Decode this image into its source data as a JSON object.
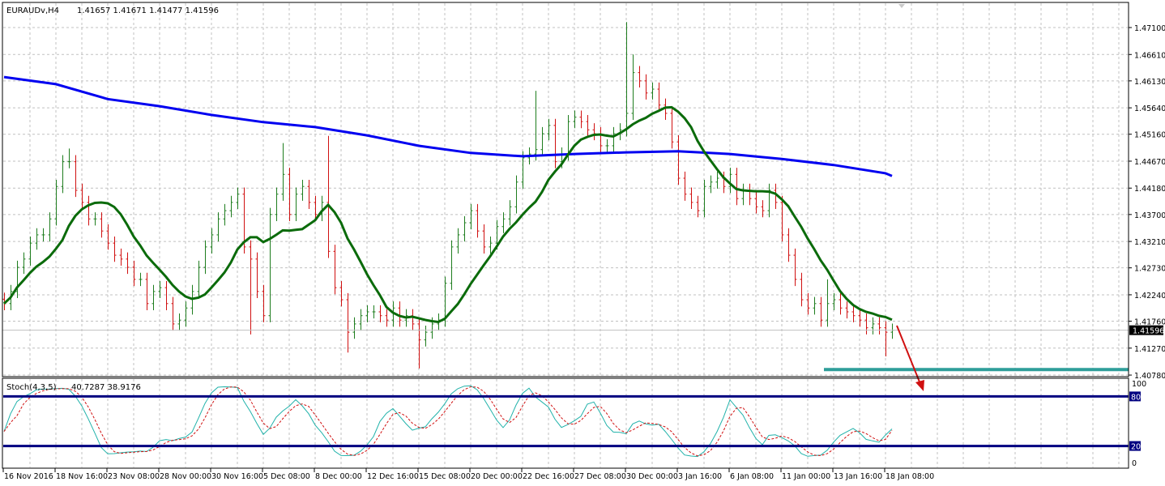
{
  "header": {
    "symbol": "EURAUDv,H4",
    "ohlc": "1.41657 1.41671 1.41477 1.41596"
  },
  "stoch_header": {
    "name": "Stoch(4,3,5)",
    "values": "40.7287 38.9176"
  },
  "colors": {
    "bull_bar": "#1e7d1e",
    "bear_bar": "#d01010",
    "ma_fast": "#0b6b0b",
    "ma_slow": "#0000f0",
    "stoch_main": "#20b2aa",
    "stoch_signal": "#d01010",
    "stoch_levels": "#000080",
    "support_line": "#2e9e9a",
    "arrow": "#d01010",
    "grid": "#c0c0c0"
  },
  "chart_data": [
    {
      "type": "bar",
      "subtype": "ohlc",
      "title": "EURAUDv,H4",
      "price_axis": {
        "ticks": [
          "1.47100",
          "1.46610",
          "1.46130",
          "1.45640",
          "1.45160",
          "1.44670",
          "1.44180",
          "1.43700",
          "1.43210",
          "1.42730",
          "1.42240",
          "1.41760",
          "1.41270",
          "1.40780"
        ],
        "ylim": [
          1.4065,
          1.474
        ],
        "current_price": "1.41596"
      },
      "time_axis": {
        "ticks": [
          "16 Nov 2016",
          "18 Nov 16:00",
          "23 Nov 08:00",
          "28 Nov 00:00",
          "30 Nov 16:00",
          "5 Dec 08:00",
          "8 Dec 00:00",
          "12 Dec 16:00",
          "15 Dec 08:00",
          "20 Dec 00:00",
          "22 Dec 16:00",
          "27 Dec 08:00",
          "30 Dec 00:00",
          "3 Jan 16:00",
          "6 Jan 08:00",
          "11 Jan 00:00",
          "13 Jan 16:00",
          "18 Jan 08:00"
        ]
      },
      "grid": true,
      "closes": [
        1.4208,
        1.423,
        1.4274,
        1.4289,
        1.4318,
        1.4333,
        1.4333,
        1.4362,
        1.4421,
        1.4466,
        1.4466,
        1.4414,
        1.4392,
        1.4362,
        1.4362,
        1.434,
        1.4318,
        1.4296,
        1.4289,
        1.4274,
        1.4252,
        1.4252,
        1.4208,
        1.423,
        1.4237,
        1.4208,
        1.4171,
        1.4178,
        1.42,
        1.423,
        1.4274,
        1.4311,
        1.4333,
        1.4362,
        1.4377,
        1.4392,
        1.4407,
        1.4311,
        1.4289,
        1.423,
        1.4186,
        1.437,
        1.4407,
        1.4443,
        1.437,
        1.4407,
        1.4421,
        1.4392,
        1.437,
        1.4392,
        1.4303,
        1.4237,
        1.4215,
        1.4156,
        1.4171,
        1.4186,
        1.4193,
        1.4193,
        1.4186,
        1.4178,
        1.42,
        1.4178,
        1.4186,
        1.4171,
        1.4142,
        1.4156,
        1.4171,
        1.4178,
        1.4245,
        1.4311,
        1.4333,
        1.4355,
        1.4377,
        1.434,
        1.4311,
        1.4318,
        1.4348,
        1.4362,
        1.4384,
        1.4429,
        1.4473,
        1.448,
        1.4488,
        1.4517,
        1.4532,
        1.4466,
        1.448,
        1.4539,
        1.4547,
        1.4539,
        1.4524,
        1.4517,
        1.4495,
        1.4495,
        1.4517,
        1.4524,
        1.4554,
        1.4628,
        1.4613,
        1.4591,
        1.4598,
        1.4569,
        1.4554,
        1.4502,
        1.4436,
        1.4407,
        1.4392,
        1.4377,
        1.4421,
        1.4429,
        1.4436,
        1.4421,
        1.4443,
        1.4399,
        1.4414,
        1.4399,
        1.4384,
        1.4377,
        1.4414,
        1.4392,
        1.4333,
        1.4296,
        1.4252,
        1.4215,
        1.42,
        1.4208,
        1.4178,
        1.4208,
        1.4215,
        1.42,
        1.4193,
        1.4186,
        1.4178,
        1.4164,
        1.4171,
        1.4164,
        1.4156,
        1.41596
      ],
      "extremes": [
        {
          "bar": 10,
          "high": 1.449
        },
        {
          "bar": 38,
          "low": 1.4152
        },
        {
          "bar": 43,
          "high": 1.45
        },
        {
          "bar": 50,
          "high": 1.4513
        },
        {
          "bar": 53,
          "low": 1.4119
        },
        {
          "bar": 64,
          "low": 1.409
        },
        {
          "bar": 82,
          "high": 1.4595
        },
        {
          "bar": 96,
          "high": 1.472
        },
        {
          "bar": 97,
          "high": 1.4661
        },
        {
          "bar": 127,
          "high": 1.4252
        },
        {
          "bar": 136,
          "low": 1.4112
        }
      ],
      "slow_ma_at_time_ticks": [
        1.462,
        1.4607,
        1.458,
        1.4567,
        1.4551,
        1.4538,
        1.4529,
        1.4514,
        1.4495,
        1.4482,
        1.4476,
        1.448,
        1.4483,
        1.4485,
        1.448,
        1.4471,
        1.446,
        1.4445,
        1.444
      ],
      "support_level": 1.4088
    },
    {
      "type": "line",
      "title": "Stoch(4,3,5)",
      "ylim": [
        0,
        100
      ],
      "levels": [
        "80",
        "20"
      ],
      "axis_ticks": [
        "100",
        "0"
      ],
      "last_values": {
        "main": 40.7287,
        "signal": 38.9176
      }
    }
  ]
}
